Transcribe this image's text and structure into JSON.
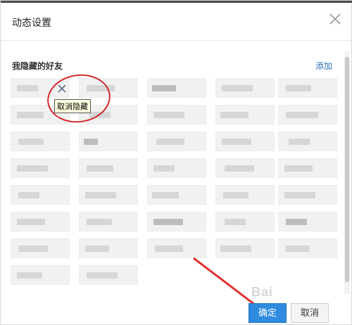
{
  "dialog": {
    "title": "动态设置",
    "section_title": "我隐藏的好友",
    "add_label": "添加",
    "tooltip": "取消隐藏",
    "ok_label": "确定",
    "cancel_label": "取消",
    "watermark": "Bai"
  },
  "colors": {
    "accent": "#2e8be0",
    "link": "#2a6fb8",
    "annotation": "#d62a2a"
  },
  "icons": {
    "close": "close-icon",
    "remove": "close-icon"
  }
}
